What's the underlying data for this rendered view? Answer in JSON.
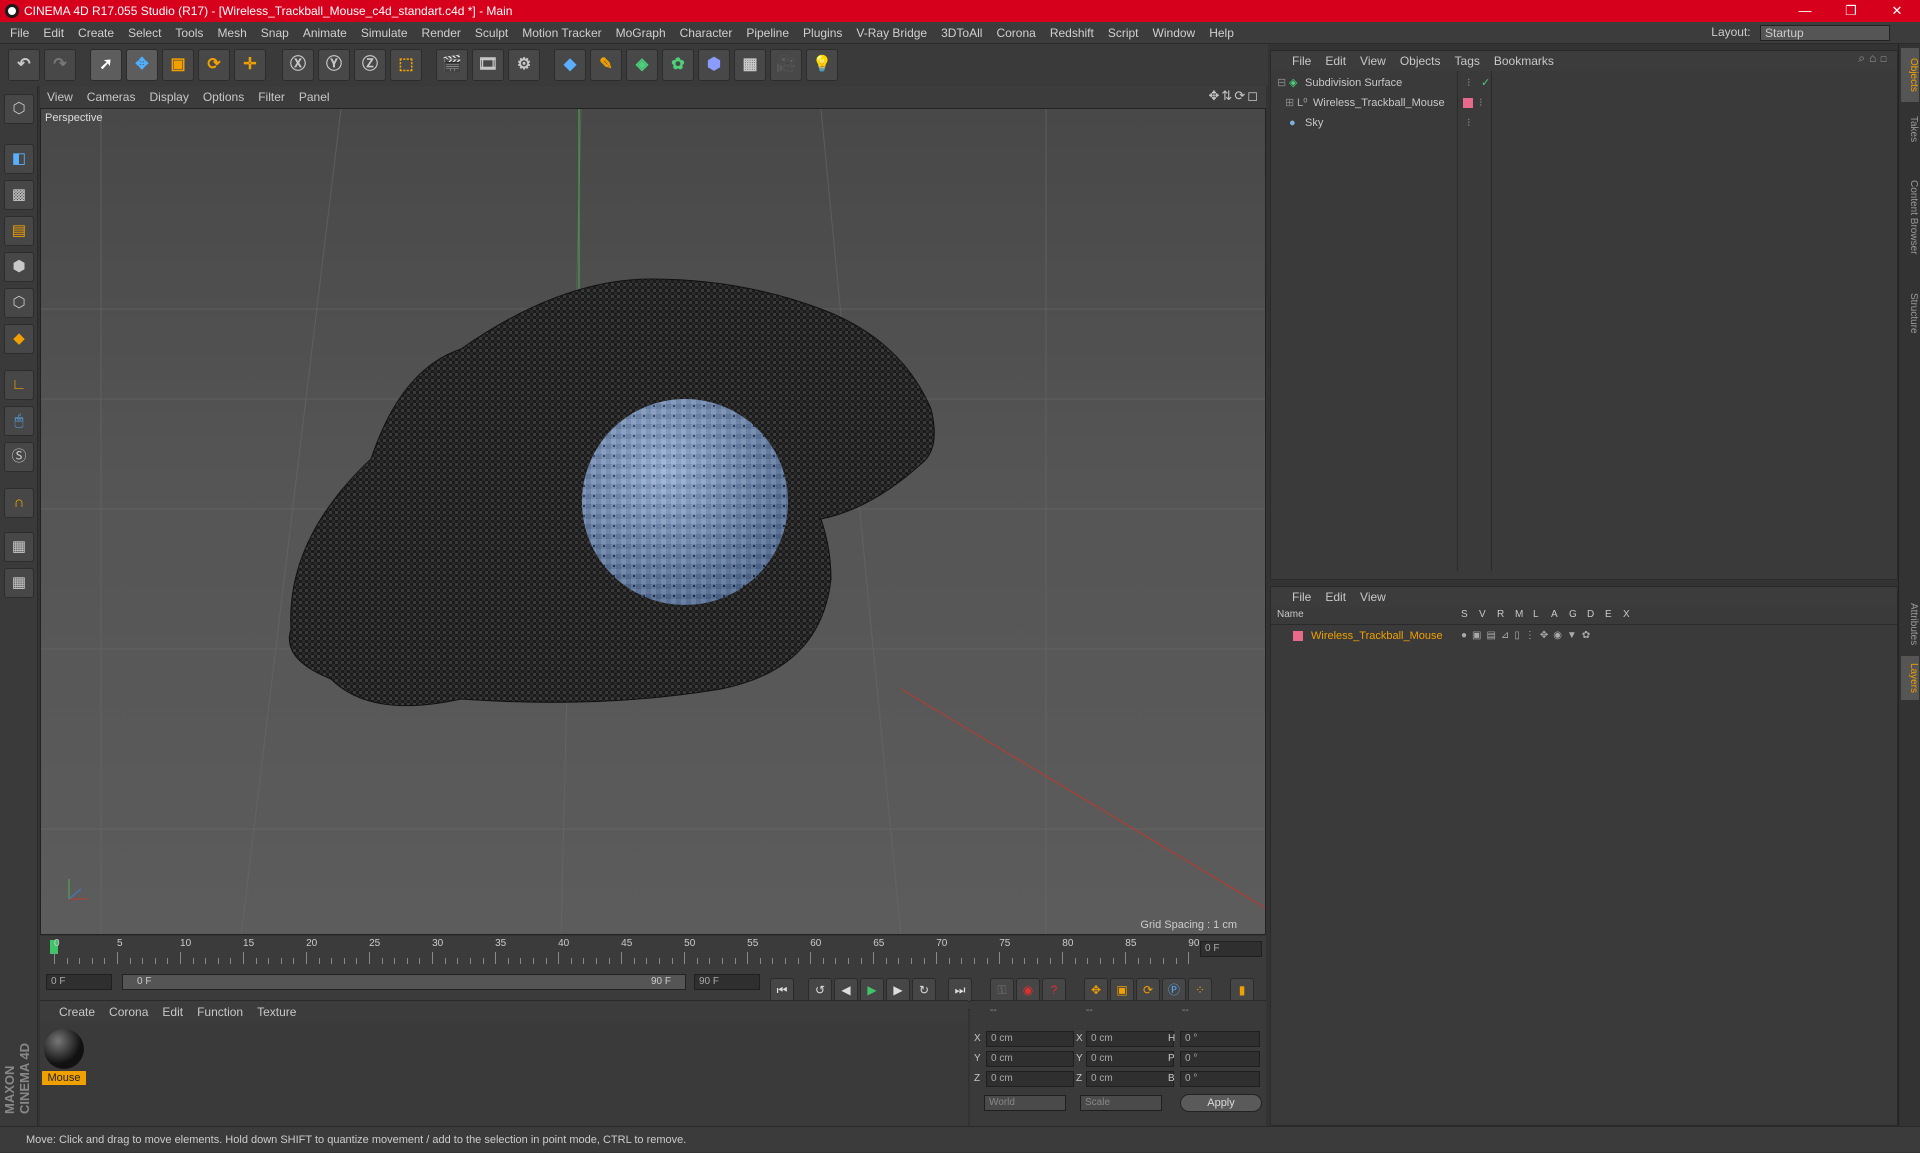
{
  "window": {
    "title": "CINEMA 4D R17.055 Studio (R17) - [Wireless_Trackball_Mouse_c4d_standart.c4d *] - Main",
    "minimize": "—",
    "maximize": "❐",
    "close": "✕"
  },
  "menubar": {
    "items": [
      "File",
      "Edit",
      "Create",
      "Select",
      "Tools",
      "Mesh",
      "Snap",
      "Animate",
      "Simulate",
      "Render",
      "Sculpt",
      "Motion Tracker",
      "MoGraph",
      "Character",
      "Pipeline",
      "Plugins",
      "V-Ray Bridge",
      "3DToAll",
      "Corona",
      "Redshift",
      "Script",
      "Window",
      "Help"
    ],
    "layout_label": "Layout:",
    "layout_value": "Startup"
  },
  "viewport": {
    "menu": [
      "View",
      "Cameras",
      "Display",
      "Options",
      "Filter",
      "Panel"
    ],
    "label": "Perspective",
    "grid_spacing": "Grid Spacing : 1 cm"
  },
  "timeline": {
    "ticks": [
      "0",
      "5",
      "10",
      "15",
      "20",
      "25",
      "30",
      "35",
      "40",
      "45",
      "50",
      "55",
      "60",
      "65",
      "70",
      "75",
      "80",
      "85",
      "90"
    ],
    "current_frame": "0 F",
    "start_field": "0 F",
    "slider_start": "0 F",
    "slider_end": "90 F",
    "end_field": "90 F"
  },
  "material_manager": {
    "menu": [
      "Create",
      "Corona",
      "Edit",
      "Function",
      "Texture"
    ],
    "material_name": "Mouse"
  },
  "coordinates": {
    "headers": [
      "--",
      "--",
      "--"
    ],
    "rows": [
      {
        "a": "X",
        "av": "0 cm",
        "b": "X",
        "bv": "0 cm",
        "c": "H",
        "cv": "0 °"
      },
      {
        "a": "Y",
        "av": "0 cm",
        "b": "Y",
        "bv": "0 cm",
        "c": "P",
        "cv": "0 °"
      },
      {
        "a": "Z",
        "av": "0 cm",
        "b": "Z",
        "bv": "0 cm",
        "c": "B",
        "cv": "0 °"
      }
    ],
    "mode1": "World",
    "mode2": "Scale",
    "apply": "Apply"
  },
  "object_manager": {
    "menu": [
      "File",
      "Edit",
      "View",
      "Objects",
      "Tags",
      "Bookmarks"
    ],
    "objects": [
      {
        "name": "Subdivision Surface"
      },
      {
        "name": "Wireless_Trackball_Mouse"
      },
      {
        "name": "Sky"
      }
    ]
  },
  "layer_manager": {
    "menu": [
      "File",
      "Edit",
      "View"
    ],
    "name_header": "Name",
    "columns": [
      "S",
      "V",
      "R",
      "M",
      "L",
      "A",
      "G",
      "D",
      "E",
      "X"
    ],
    "layer_name": "Wireless_Trackball_Mouse"
  },
  "right_tabs": [
    "Objects",
    "Takes",
    "Content Browser",
    "Structure",
    "Attributes",
    "Layers"
  ],
  "brand": "MAXON CINEMA 4D",
  "status": "Move: Click and drag to move elements. Hold down SHIFT to quantize movement / add to the selection in point mode, CTRL to remove.",
  "colors": {
    "titlebar": "#d6001c",
    "accent_orange": "#f0a000",
    "layer_color": "#e86a8a",
    "ball_blue": "#6f8fbf"
  }
}
